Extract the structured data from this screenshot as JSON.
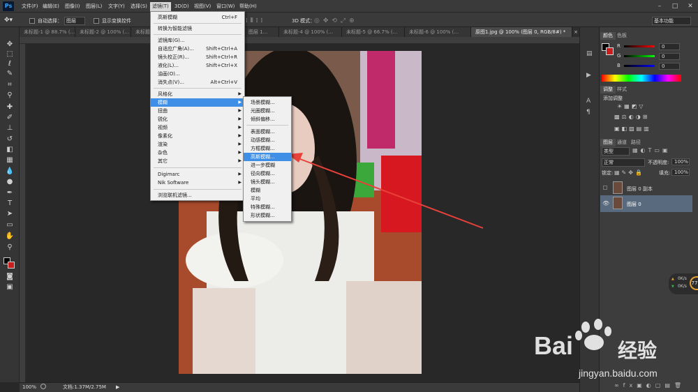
{
  "app": {
    "logo": "Ps"
  },
  "menubar": {
    "items": [
      "文件(F)",
      "编辑(E)",
      "图像(I)",
      "图层(L)",
      "文字(Y)",
      "选择(S)",
      "滤镜(T)",
      "3D(D)",
      "视图(V)",
      "窗口(W)",
      "帮助(H)"
    ],
    "win_min": "–",
    "win_max": "□",
    "win_close": "✕"
  },
  "options": {
    "auto_select_label": "自动选择：",
    "auto_select_value": "图层",
    "show_transform_label": "显示变换控件",
    "mode_3d": "3D 模式：",
    "workspace": "基本功能"
  },
  "tabs": [
    "未标题-1 @ 88.7% (...",
    "未标题-2 @ 100% (...",
    "未标题-3 ...",
    "图层 1...",
    "未标题-4 @ 100% (...",
    "未标题-5 @ 66.7% (...",
    "未标题-6 @ 100% (...",
    "原图1.jpg @ 100% (图层 0, RGB/8#) *"
  ],
  "tab_close": "×",
  "status": {
    "zoom": "100%",
    "doc": "文档:1.37M/2.75M",
    "arrow": "▶"
  },
  "filter_menu": {
    "items": [
      {
        "label": "高斯模糊",
        "shortcut": "Ctrl+F"
      },
      {
        "label": "转换为智能滤镜",
        "shortcut": ""
      },
      {
        "label": "滤镜库(G)...",
        "shortcut": ""
      },
      {
        "label": "自适应广角(A)...",
        "shortcut": "Shift+Ctrl+A"
      },
      {
        "label": "镜头校正(R)...",
        "shortcut": "Shift+Ctrl+R"
      },
      {
        "label": "液化(L)...",
        "shortcut": "Shift+Ctrl+X"
      },
      {
        "label": "油画(O)...",
        "shortcut": ""
      },
      {
        "label": "消失点(V)...",
        "shortcut": "Alt+Ctrl+V"
      },
      {
        "label": "风格化",
        "shortcut": ""
      },
      {
        "label": "模糊",
        "shortcut": ""
      },
      {
        "label": "扭曲",
        "shortcut": ""
      },
      {
        "label": "锐化",
        "shortcut": ""
      },
      {
        "label": "视频",
        "shortcut": ""
      },
      {
        "label": "像素化",
        "shortcut": ""
      },
      {
        "label": "渲染",
        "shortcut": ""
      },
      {
        "label": "杂色",
        "shortcut": ""
      },
      {
        "label": "其它",
        "shortcut": ""
      },
      {
        "label": "Digimarc",
        "shortcut": ""
      },
      {
        "label": "Nik Software",
        "shortcut": ""
      },
      {
        "label": "浏览联机滤镜...",
        "shortcut": ""
      }
    ],
    "submenu_arrow": "▶"
  },
  "blur_submenu": {
    "items": [
      "场景模糊...",
      "光圈模糊...",
      "倾斜偏移...",
      "表面模糊...",
      "动感模糊...",
      "方框模糊...",
      "高斯模糊...",
      "进一步模糊",
      "径向模糊...",
      "镜头模糊...",
      "模糊",
      "平均",
      "特殊模糊...",
      "形状模糊..."
    ]
  },
  "color_panel": {
    "tab1": "颜色",
    "tab2": "色板",
    "r_label": "R",
    "g_label": "G",
    "b_label": "B",
    "r": "0",
    "g": "0",
    "b": "0"
  },
  "adjust_panel": {
    "tab1": "调整",
    "tab2": "样式",
    "title": "添加调整"
  },
  "layers_panel": {
    "tab1": "图层",
    "tab2": "通道",
    "tab3": "路径",
    "kind": "类型",
    "blend": "正常",
    "opacity_label": "不透明度:",
    "opacity": "100%",
    "lock_label": "锁定:",
    "fill_label": "填充:",
    "fill": "100%",
    "layers": [
      {
        "name": "图层 0 副本"
      },
      {
        "name": "图层 0"
      }
    ]
  },
  "net": {
    "up": "0K/s",
    "down": "0K/s",
    "badge": "77"
  },
  "watermark": {
    "brand": "Bai",
    "brand2": "经验",
    "url": "jingyan.baidu.com"
  },
  "colors": {
    "accent": "#3f8fe6",
    "arrow": "#e8413a",
    "bg": "#282828"
  }
}
